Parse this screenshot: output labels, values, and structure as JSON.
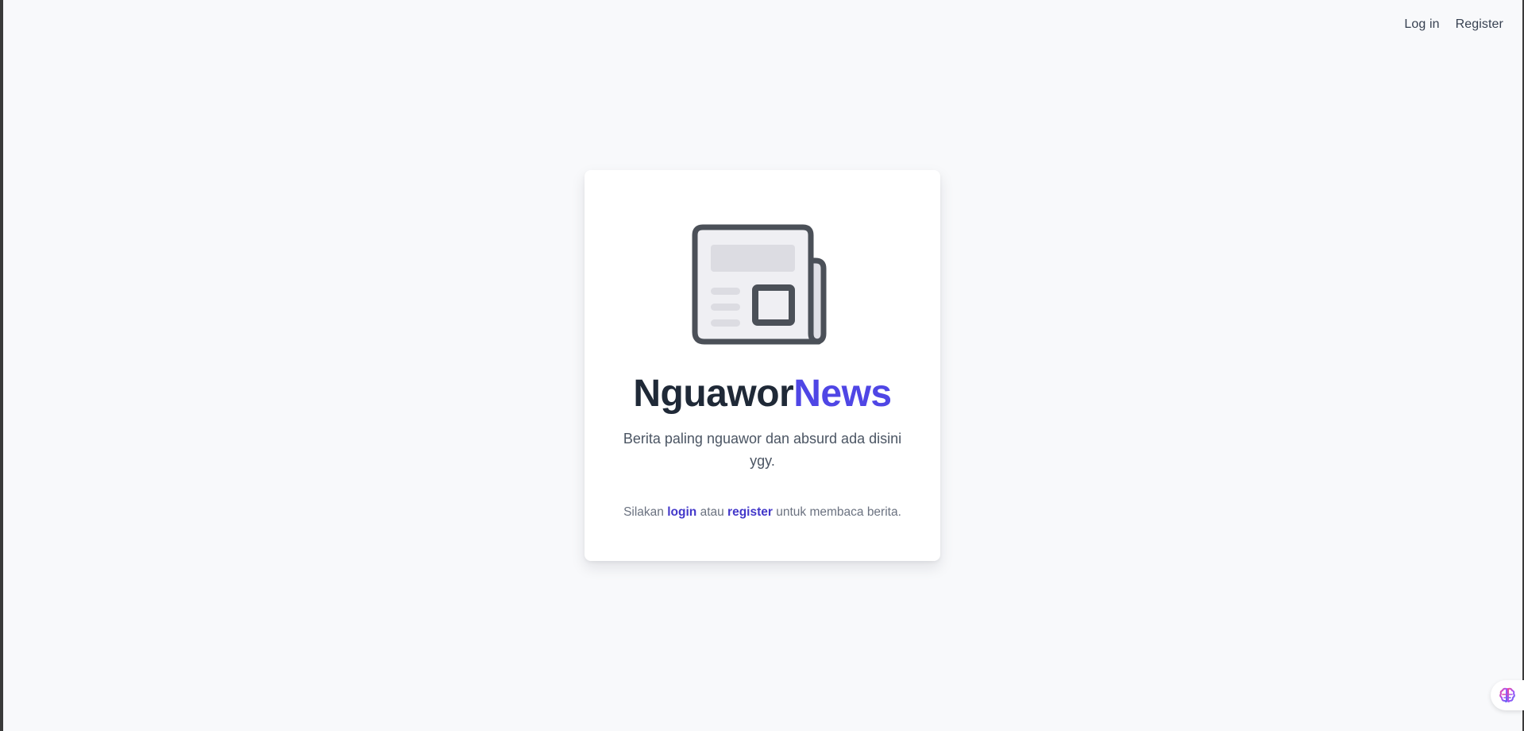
{
  "nav": {
    "login_label": "Log in",
    "register_label": "Register"
  },
  "hero": {
    "logo_icon": "newspaper-icon",
    "title_part1": "Nguawor",
    "title_part2": "News",
    "tagline": "Berita paling nguawor dan absurd ada disini ygy.",
    "cta_prefix": "Silakan ",
    "cta_login_link": "login",
    "cta_middle": " atau ",
    "cta_register_link": "register",
    "cta_suffix": " untuk membaca berita."
  },
  "floating": {
    "assistant_icon": "brain-icon"
  },
  "colors": {
    "background": "#f8f9fb",
    "card": "#ffffff",
    "accent": "#4f46e5",
    "link": "#4338ca",
    "title_dark": "#1f2937",
    "icon_stroke": "#4b5058",
    "icon_fill": "#e0e0e6"
  }
}
